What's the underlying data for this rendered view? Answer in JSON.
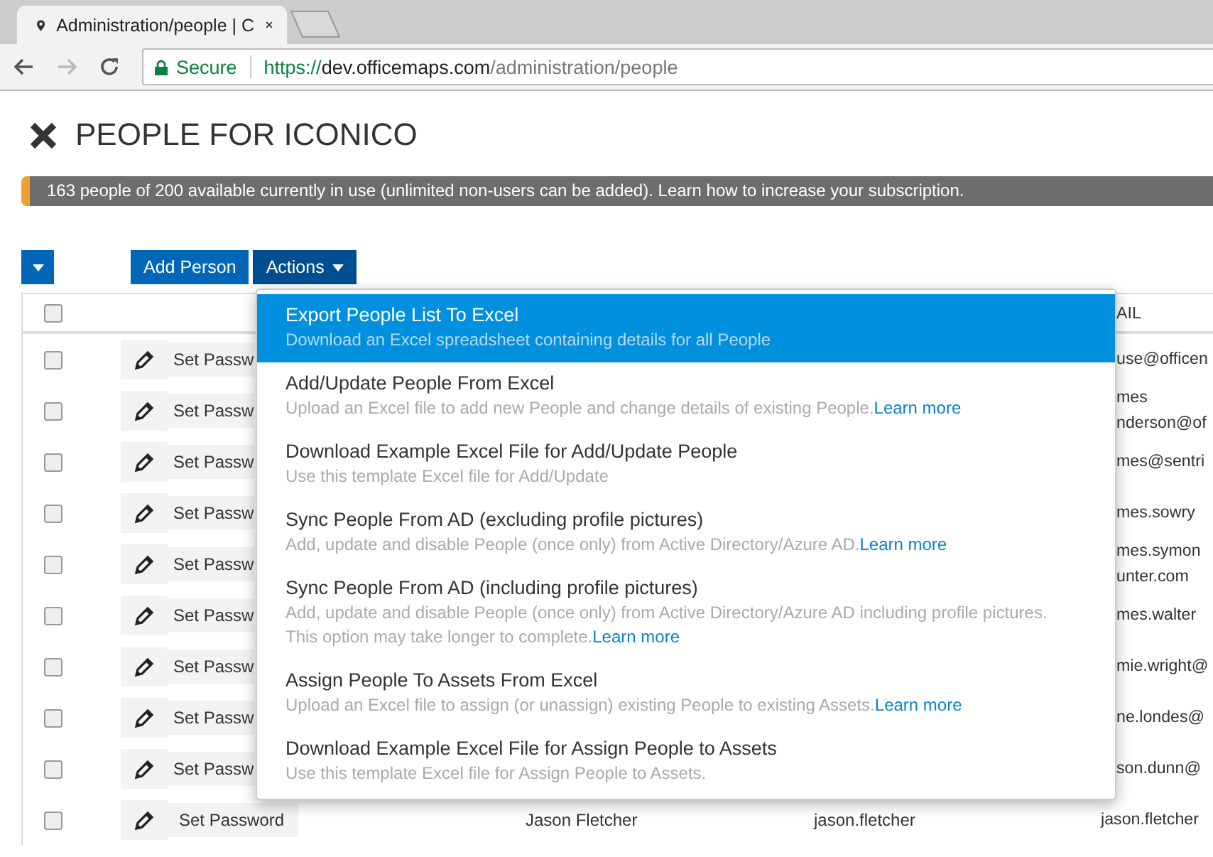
{
  "browser": {
    "tab_title": "Administration/people | C",
    "secure_label": "Secure",
    "url_scheme": "https://",
    "url_host": "dev.officemaps.com",
    "url_path": "/administration/people"
  },
  "page_title": "PEOPLE FOR ICONICO",
  "banner": "163 people of 200 available currently in use (unlimited non-users can be added). Learn how to increase your subscription.",
  "toolbar": [
    {
      "kind": "caret",
      "expanded": false
    },
    {
      "kind": "plain",
      "label": "Add Person",
      "expanded": false
    },
    {
      "kind": "dropdown",
      "label": "Actions",
      "expanded": true
    }
  ],
  "table": {
    "header": {
      "checked": false,
      "email_heading": "AIL"
    },
    "rows": [
      {
        "checked": false,
        "password": "Set Passw",
        "email_lines": [
          "use@officen"
        ]
      },
      {
        "checked": false,
        "password": "Set Passw",
        "email_lines": [
          "mes",
          "nderson@of"
        ]
      },
      {
        "checked": false,
        "password": "Set Passw",
        "email_lines": [
          "mes@sentri"
        ]
      },
      {
        "checked": false,
        "password": "Set Passw",
        "email_lines": [
          "mes.sowry"
        ]
      },
      {
        "checked": false,
        "password": "Set Passw",
        "email_lines": [
          "mes.symon",
          "unter.com"
        ]
      },
      {
        "checked": false,
        "password": "Set Passw",
        "email_lines": [
          "mes.walter"
        ]
      },
      {
        "checked": false,
        "password": "Set Passw",
        "email_lines": [
          "mie.wright@"
        ]
      },
      {
        "checked": false,
        "password": "Set Passw",
        "email_lines": [
          "ne.londes@"
        ]
      },
      {
        "checked": false,
        "password": "Set Passw",
        "email_lines": [
          "son.dunn@"
        ]
      },
      {
        "checked": false,
        "password": "Set Password",
        "name": "Jason Fletcher",
        "login": "jason.fletcher",
        "email_lines": [
          "jason.fletcher"
        ]
      }
    ]
  },
  "actions_menu": [
    {
      "selected": true,
      "title": "Export People List To Excel",
      "desc_lines": [
        "Download an Excel spreadsheet containing details for all People"
      ]
    },
    {
      "selected": false,
      "title": "Add/Update People From Excel",
      "desc_lines": [
        "Upload an Excel file to add new People and change details of existing People."
      ],
      "link": "Learn more"
    },
    {
      "selected": false,
      "title": "Download Example Excel File for Add/Update People",
      "desc_lines": [
        "Use this template Excel file for Add/Update"
      ]
    },
    {
      "selected": false,
      "title": "Sync People From AD (excluding profile pictures)",
      "desc_lines": [
        "Add, update and disable People (once only) from Active Directory/Azure AD."
      ],
      "link": "Learn more"
    },
    {
      "selected": false,
      "title": "Sync People From AD (including profile pictures)",
      "desc_lines": [
        "Add, update and disable People (once only) from Active Directory/Azure AD including profile pictures.",
        "This option may take longer to complete."
      ],
      "link": "Learn more"
    },
    {
      "selected": false,
      "title": "Assign People To Assets From Excel",
      "desc_lines": [
        "Upload an Excel file to assign (or unassign) existing People to existing Assets."
      ],
      "link": "Learn more"
    },
    {
      "selected": false,
      "title": "Download Example Excel File for Assign People to Assets",
      "desc_lines": [
        "Use this template Excel file for Assign People to Assets."
      ]
    }
  ]
}
